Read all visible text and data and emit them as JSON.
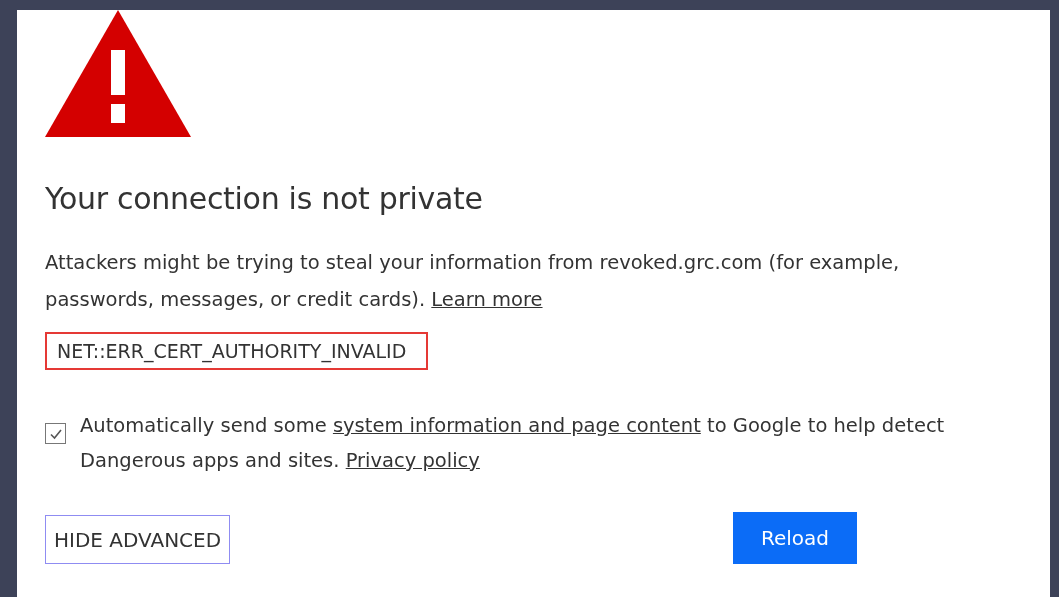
{
  "heading": "Your connection is not private",
  "description": [
    {
      "kind": "text",
      "text": "Attackers might be trying to steal your information from revoked.grc.com (for example, passwords, messages, or credit cards). "
    },
    {
      "kind": "link",
      "text": "Learn more"
    }
  ],
  "error_code": "NET::ERR_CERT_AUTHORITY_INVALID",
  "report": {
    "checked": true,
    "parts": [
      {
        "kind": "text",
        "text": "Automatically send some "
      },
      {
        "kind": "link",
        "text": "system information and page content"
      },
      {
        "kind": "text",
        "text": " to Google to help detect Dangerous apps and sites. "
      },
      {
        "kind": "link",
        "text": "Privacy policy"
      }
    ]
  },
  "buttons": [
    {
      "kind": "secondary",
      "label": "HIDE ADVANCED"
    },
    {
      "kind": "primary",
      "label": "Reload"
    }
  ]
}
